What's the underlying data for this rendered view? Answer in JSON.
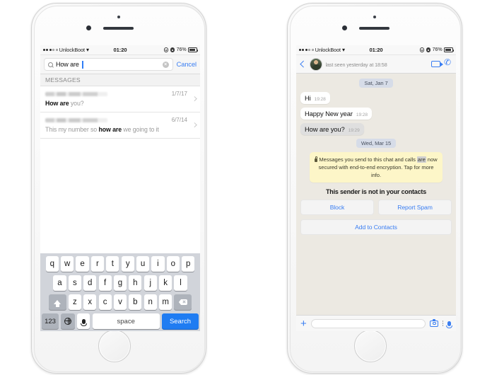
{
  "statusbar": {
    "carrier": "UnlockBoot",
    "time": "01:20",
    "battery_pct": "76%",
    "signal_icon": "signal-dots-icon",
    "wifi_icon": "wifi-icon",
    "location_icon": "location-services-icon",
    "lock_icon": "rotation-lock-icon",
    "battery_icon": "battery-icon"
  },
  "left_phone": {
    "search": {
      "value": "How are",
      "search_icon": "search-icon",
      "clear_icon": "clear-text-icon",
      "cancel_label": "Cancel"
    },
    "section_header": "MESSAGES",
    "results": [
      {
        "sender": "",
        "date": "1/7/17",
        "preview_match": "How are",
        "preview_rest": " you?",
        "match_first": true,
        "chevron": "chevron-right-icon"
      },
      {
        "sender": "",
        "date": "6/7/14",
        "preview_before": "This my number so ",
        "preview_match": "how are",
        "preview_after": " we going to it",
        "match_first": false,
        "chevron": "chevron-right-icon"
      }
    ],
    "keyboard": {
      "row1": [
        "q",
        "w",
        "e",
        "r",
        "t",
        "y",
        "u",
        "i",
        "o",
        "p"
      ],
      "row2": [
        "a",
        "s",
        "d",
        "f",
        "g",
        "h",
        "j",
        "k",
        "l"
      ],
      "row3": [
        "z",
        "x",
        "c",
        "v",
        "b",
        "n",
        "m"
      ],
      "shift_icon": "shift-key-icon",
      "delete_icon": "backspace-key-icon",
      "numbers_label": "123",
      "globe_icon": "globe-key-icon",
      "mic_icon": "microphone-key-icon",
      "space_label": "space",
      "search_label": "Search",
      "search_key_color": "#1f7cf2"
    }
  },
  "right_phone": {
    "header": {
      "back_icon": "back-chevron-icon",
      "avatar": "contact-avatar",
      "contact_name": "",
      "status": "last seen yesterday at 18:58",
      "video_icon": "video-call-icon",
      "call_icon": "voice-call-icon"
    },
    "conversation": [
      {
        "kind": "date",
        "label": "Sat, Jan 7"
      },
      {
        "kind": "bubble",
        "text": "Hi",
        "time": "19:28",
        "highlighted": false
      },
      {
        "kind": "bubble",
        "text": "Happy New year",
        "time": "19:28",
        "highlighted": false
      },
      {
        "kind": "bubble",
        "text": "How are you?",
        "time": "19:29",
        "highlighted": true
      },
      {
        "kind": "date",
        "label": "Wed, Mar 15"
      }
    ],
    "encryption_notice": {
      "lock_icon": "lock-icon",
      "part1": "Messages you send to this chat and calls ",
      "highlight": "are",
      "part2": " now secured with end-to-end encryption. Tap for more info."
    },
    "not_contact_text": "This sender is not in your contacts",
    "actions": {
      "block_label": "Block",
      "report_label": "Report Spam",
      "add_label": "Add to Contacts"
    },
    "composer": {
      "plus_icon": "attach-plus-icon",
      "input_value": "",
      "camera_icon": "camera-icon",
      "more_icon": "more-options-icon",
      "mic_icon": "microphone-icon"
    }
  },
  "colors": {
    "accent_blue": "#3a7ef2",
    "chat_background": "#ece9e2",
    "encryption_yellow": "#fdf6c8",
    "date_pill": "#d6dce8"
  }
}
